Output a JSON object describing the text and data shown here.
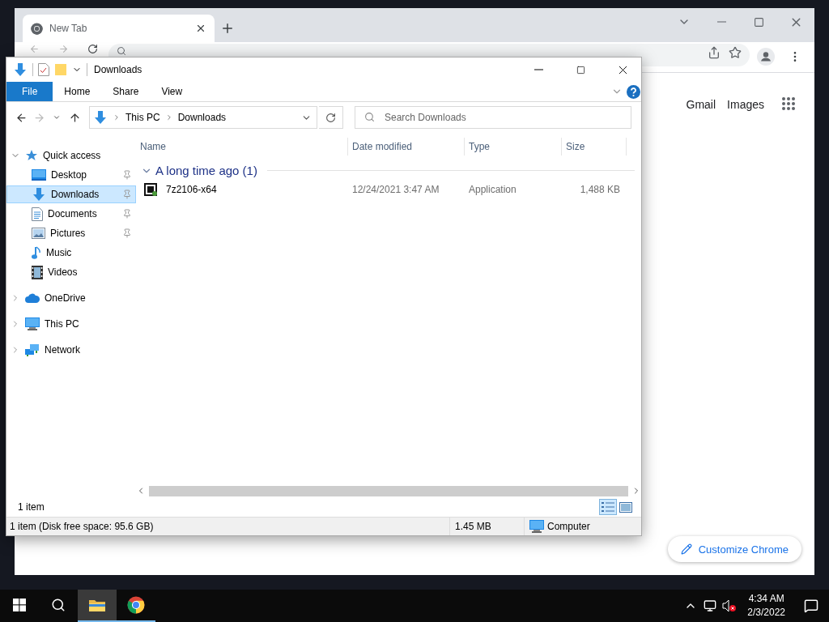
{
  "chrome": {
    "tabs": [
      {
        "title": "New Tab",
        "selected": true
      }
    ],
    "links": [
      "Gmail",
      "Images"
    ],
    "customize_button": "Customize Chrome"
  },
  "explorer": {
    "title": "Downloads",
    "ribbon_tabs": [
      {
        "label": "File",
        "selected": true
      },
      {
        "label": "Home",
        "selected": false
      },
      {
        "label": "Share",
        "selected": false
      },
      {
        "label": "View",
        "selected": false
      }
    ],
    "breadcrumb": [
      "This PC",
      "Downloads"
    ],
    "search": {
      "placeholder": "Search Downloads"
    },
    "nav": [
      {
        "kind": "quick",
        "label": "Quick access",
        "expanded": true,
        "selected": false,
        "children": [
          {
            "kind": "desktop",
            "label": "Desktop",
            "pinned": true,
            "selected": false
          },
          {
            "kind": "downloads",
            "label": "Downloads",
            "pinned": true,
            "selected": true
          },
          {
            "kind": "documents",
            "label": "Documents",
            "pinned": true,
            "selected": false
          },
          {
            "kind": "pictures",
            "label": "Pictures",
            "pinned": true,
            "selected": false
          },
          {
            "kind": "music",
            "label": "Music",
            "pinned": false,
            "selected": false
          },
          {
            "kind": "videos",
            "label": "Videos",
            "pinned": false,
            "selected": false
          }
        ]
      },
      {
        "kind": "onedrive",
        "label": "OneDrive",
        "expanded": false,
        "selected": false
      },
      {
        "kind": "pc",
        "label": "This PC",
        "expanded": false,
        "selected": false
      },
      {
        "kind": "network",
        "label": "Network",
        "expanded": false,
        "selected": false
      }
    ],
    "columns": [
      "Name",
      "Date modified",
      "Type",
      "Size"
    ],
    "groups": [
      {
        "title": "A long time ago (1)",
        "expanded": true,
        "files": [
          {
            "name": "7z2106-x64",
            "date": "12/24/2021 3:47 AM",
            "type": "Application",
            "size": "1,488 KB"
          }
        ]
      }
    ],
    "item_count": "1 item",
    "views": [
      {
        "kind": "details",
        "selected": true
      },
      {
        "kind": "tiles",
        "selected": false
      }
    ],
    "status": {
      "text": "1 item (Disk free space: 95.6 GB)",
      "size": "1.45 MB",
      "location": "Computer"
    }
  },
  "taskbar": {
    "apps": [
      {
        "kind": "explorer",
        "selected": true
      },
      {
        "kind": "chrome",
        "selected": false
      }
    ],
    "time": "4:34 AM",
    "date": "2/3/2022"
  }
}
